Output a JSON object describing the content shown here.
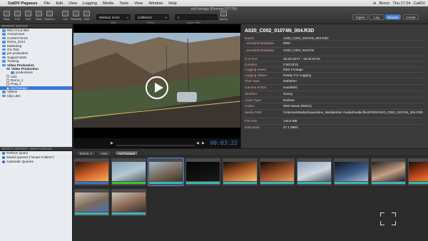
{
  "menubar": {
    "app": "CatDV Pegasus",
    "menus": [
      "File",
      "Edit",
      "View",
      "Logging",
      "Media",
      "Tools",
      "View",
      "Window",
      "Help"
    ],
    "user": "Brevn",
    "clock": "Thu 17:24",
    "app_right": "CatDV"
  },
  "toolbar": {
    "title": "red footage (Remote 017:24)",
    "buttons": [
      "Back",
      "Fwd",
      "Edit",
      "Save",
      "Markers",
      "List",
      "Filmstrip",
      "Grid"
    ],
    "view_select": "Medium Icons",
    "view_label": "View",
    "filter_select": "Unfiltered",
    "filter_label": "Filters",
    "search_placeholder": "",
    "search_label": "Quick Filter",
    "query_label": "Query",
    "right_buttons": [
      "Ingest",
      "Log",
      "Browse",
      "Create"
    ],
    "active_right": "Browse"
  },
  "left_panel": {
    "browse_header": "BROWSE SERVER",
    "tree": [
      {
        "label": "RECYCLE BIN",
        "indent": 0,
        "kind": "folder"
      },
      {
        "label": "Anonymous",
        "indent": 0,
        "kind": "folder"
      },
      {
        "label": "Content forms",
        "indent": 0,
        "kind": "folder"
      },
      {
        "label": "Demo_2014",
        "indent": 0,
        "kind": "folder"
      },
      {
        "label": "Marketing",
        "indent": 0,
        "kind": "folder"
      },
      {
        "label": "OU Test",
        "indent": 0,
        "kind": "folder"
      },
      {
        "label": "pre production",
        "indent": 0,
        "kind": "folder"
      },
      {
        "label": "Support tests",
        "indent": 0,
        "kind": "folder"
      },
      {
        "label": "Training",
        "indent": 0,
        "kind": "folder"
      },
      {
        "label": "Video Production",
        "indent": 0,
        "kind": "folder",
        "bold": true
      },
      {
        "label": "Video Production",
        "indent": 1,
        "kind": "folder",
        "bold": true
      },
      {
        "label": "productions",
        "indent": 2,
        "kind": "folder"
      },
      {
        "label": "cat1",
        "indent": 1,
        "kind": "clip"
      },
      {
        "label": "Demo_1",
        "indent": 1,
        "kind": "clip"
      },
      {
        "label": "Prog_1",
        "indent": 1,
        "kind": "clip"
      },
      {
        "label": "red footage",
        "indent": 1,
        "kind": "clip",
        "selected": true
      },
      {
        "label": "Videos",
        "indent": 0,
        "kind": "folder"
      },
      {
        "label": "Clip Lists",
        "indent": 0,
        "kind": "folder"
      }
    ],
    "search_header": "SEARCH SERVER - Video Production",
    "queries": [
      "Perform Query",
      "Saved Queries (\"Smart Folders\")",
      "Automatic Queries"
    ]
  },
  "player": {
    "timecode": "00:03:22"
  },
  "metadata": {
    "title": "A020_C002_01074N_004.R3D",
    "rows": [
      {
        "k": "Name:",
        "v": "A020_C002_01074N_004.R3D"
      },
      {
        "k": "..arvested Metadata:",
        "v": "RED"
      },
      {
        "k": "..arvested Metadata:",
        "v": "A020_C002_01074N"
      },
      {
        "k": "In & Out:",
        "v": "18:33:16'17 - 18:33:20'15"
      },
      {
        "k": "Duration:",
        "v": "0:00:03'22"
      },
      {
        "k": "Logging Notes:",
        "v": "RED Footage"
      },
      {
        "k": "Logging Status :",
        "v": "Ready For Logging"
      },
      {
        "k": "Shot Type:",
        "v": "test\\ether"
      },
      {
        "k": "Camera Action:",
        "v": "Handheld"
      },
      {
        "k": "Weather",
        "v": "Sunny"
      },
      {
        "k": "Asset Type:",
        "v": "Rushes"
      },
      {
        "k": "Codec:",
        "v": "RED Movie (RED1)"
      },
      {
        "k": "Media Path:",
        "v": "/Volumes/Media/Squarebox_Media/ether media/media files/RED/A020_C002_01074N_004.R3D"
      },
      {
        "k": "File Size",
        "v": "145.6 MB"
      },
      {
        "k": "Data Rate:",
        "v": "37.1 MB/s"
      }
    ]
  },
  "tabs": [
    "Demo_1",
    "cat1",
    "red footage"
  ],
  "active_tab": "red footage",
  "thumbnails": [
    {
      "name": "clip-1",
      "bar": "#3a73c9",
      "scene": "fire"
    },
    {
      "name": "clip-2",
      "bar": "#3ec23a",
      "scene": "harbor"
    },
    {
      "name": "clip-3",
      "bar": "#3db6b3",
      "scene": "road",
      "selected": true
    },
    {
      "name": "clip-4",
      "bar": "#3db6b3",
      "scene": "dark"
    },
    {
      "name": "clip-5",
      "bar": "#3db6b3",
      "scene": "candle"
    },
    {
      "name": "clip-6",
      "bar": "#3db6b3",
      "scene": "candle2"
    },
    {
      "name": "clip-7",
      "bar": "#3db6b3",
      "scene": "city"
    },
    {
      "name": "clip-8",
      "bar": "#3db6b3",
      "scene": "night"
    },
    {
      "name": "clip-9",
      "bar": "#3db6b3",
      "scene": "woman"
    },
    {
      "name": "clip-10",
      "bar": "#3db6b3",
      "scene": "fire2"
    },
    {
      "name": "clip-11",
      "bar": "#3db6b3",
      "scene": "man"
    },
    {
      "name": "clip-12",
      "bar": "#3db6b3",
      "scene": "woman2"
    }
  ],
  "colors": {
    "accent": "#4d88e0",
    "meta_key": "#e0a0a0",
    "timecode": "#4a7ad0"
  }
}
